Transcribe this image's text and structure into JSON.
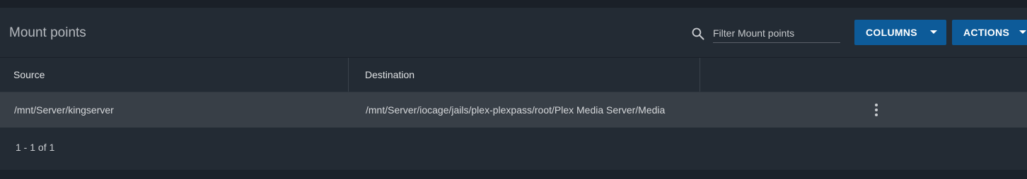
{
  "card": {
    "title": "Mount points"
  },
  "search": {
    "icon": "search-icon",
    "placeholder": "Filter Mount points",
    "value": ""
  },
  "buttons": {
    "columns_label": "COLUMNS",
    "actions_label": "ACTIONS",
    "accent_color": "#0d5b99"
  },
  "table": {
    "columns": [
      "Source",
      "Destination",
      ""
    ],
    "rows": [
      {
        "source": "/mnt/Server/kingserver",
        "destination": "/mnt/Server/iocage/jails/plex-plexpass/root/Plex Media Server/Media",
        "menu_icon": "more-vert-icon"
      }
    ]
  },
  "paginator": {
    "range_label": "1 - 1 of 1"
  }
}
